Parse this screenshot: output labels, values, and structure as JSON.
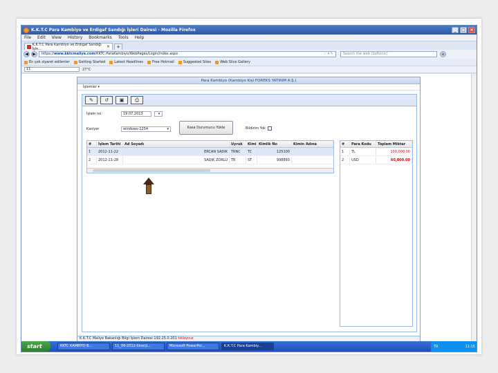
{
  "browser": {
    "title": "K.K.T.C Para Kambiyo ve Erdigaf Sandığı İşleri Dairesi - Mozilla Firefox",
    "menu": [
      "File",
      "Edit",
      "View",
      "History",
      "Bookmarks",
      "Tools",
      "Help"
    ],
    "tab_label": "K.K.T.C Para Kambiyo ve Erdigaf Sandığı İşle...",
    "url_prefix": "https://",
    "url_host": "www.kktcmaliye.com",
    "url_path": "/KKTC.ParaKambiyo/WebPages/Login/index.aspx",
    "search_placeholder": "Search the web (Softonic)",
    "bookmarks": [
      "En çok ziyaret edilenler",
      "Getting Started",
      "Latest Headlines",
      "Free Hotmail",
      "Suggested Sites",
      "Web Slice Gallery"
    ],
    "toolbar2_temp": "27°C",
    "toolbar2_text": "11"
  },
  "app": {
    "header": "Para Kambiyo (Kambiyo Kişi FOREKS YATIRIM A.Ş.)",
    "menu_label": "İşlemler",
    "labels": {
      "date": "İşlem no",
      "date_value": "19.07.2013",
      "cashier": "Kasiyer",
      "cashier_value": "windows-1254",
      "load_button": "Kasa Durumunu Yükle",
      "notify": "Bildirim Yok"
    },
    "grid_left": {
      "headers": [
        "#",
        "İşlem Tarihi",
        "Ad Soyadı",
        "Uyruk",
        "Kimi",
        "Kimlik No",
        "Kimin Adına"
      ],
      "rows": [
        [
          "1",
          "2012-11-22",
          "ERCAN SADIK",
          "TRNC",
          "TC",
          "125100",
          ""
        ],
        [
          "2",
          "2012-11-28",
          "SADIK ZORLU",
          "TR",
          "ST",
          "998893",
          ""
        ]
      ]
    },
    "grid_right": {
      "headers": [
        "#",
        "Para Kodu",
        "Toplam Miktar"
      ],
      "rows": [
        [
          "1",
          "TL",
          "100,000.00"
        ],
        [
          "2",
          "USD",
          "60,000.00"
        ]
      ]
    },
    "footer_text": "K.K.T.C Maliye Bakanlığı Bilgi İşlem Dairesi 192.25.0.201",
    "footer_link": "tıklayınız"
  },
  "taskbar": {
    "start": "start",
    "tasks": [
      "KKTC KAMBİYO B...",
      "11_09-2012-Sinerji...",
      "Microsoft PowerPoi...",
      "K.K.T.C Para Kambiy..."
    ],
    "tray_lang": "TR",
    "clock": "11:15"
  }
}
